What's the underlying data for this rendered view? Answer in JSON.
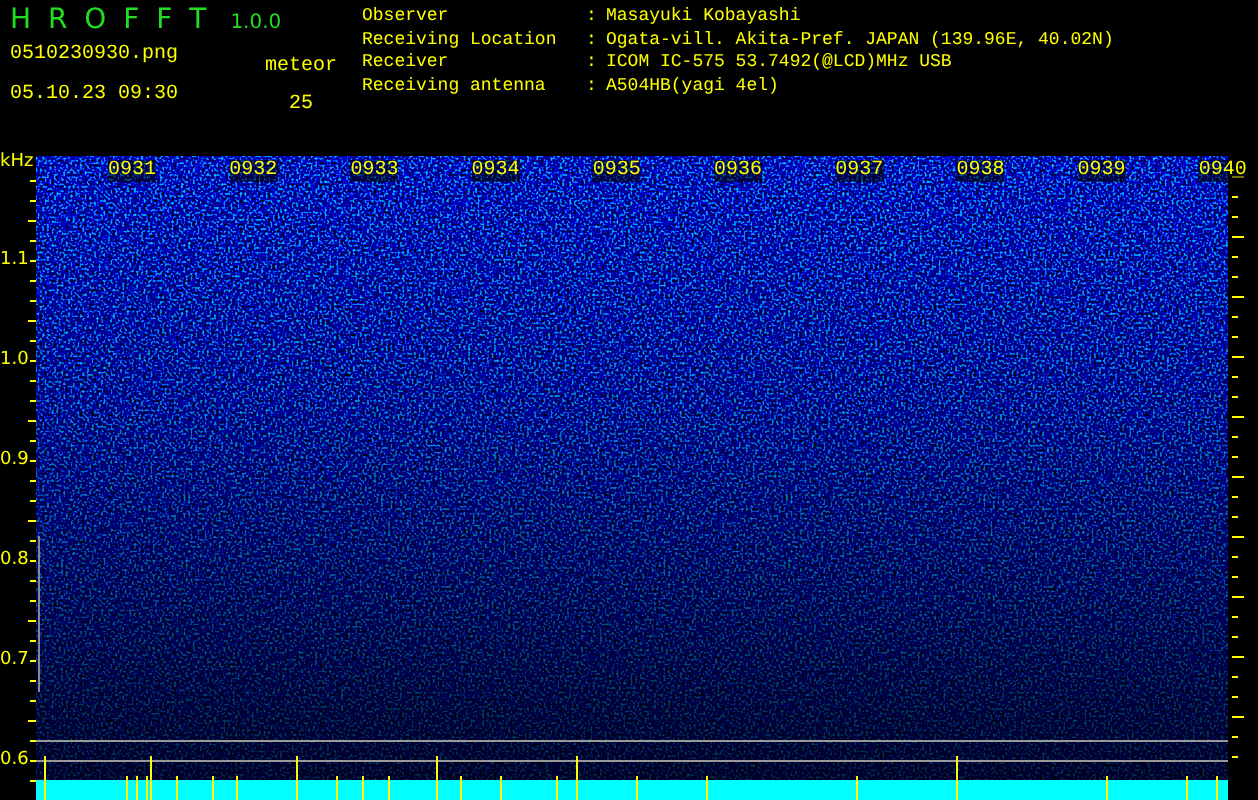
{
  "app": {
    "name": "H R O F F T",
    "version": "1.0.0"
  },
  "file": {
    "name": "0510230930.png",
    "datetime": "05.10.23 09:30"
  },
  "meteor": {
    "label": "meteor",
    "count": "25"
  },
  "info": [
    {
      "label": "Observer",
      "separator": ":",
      "value": "Masayuki Kobayashi"
    },
    {
      "label": "Receiving Location",
      "separator": ":",
      "value": "Ogata-vill. Akita-Pref. JAPAN (139.96E, 40.02N)"
    },
    {
      "label": "Receiver",
      "separator": ":",
      "value": "ICOM IC-575 53.7492(@LCD)MHz USB"
    },
    {
      "label": "Receiving antenna",
      "separator": ":",
      "value": "A504HB(yagi 4el)"
    }
  ],
  "spectrogram": {
    "unit": "kHz",
    "freq_labels": [
      "1.1",
      "1.0",
      "0.9",
      "0.8",
      "0.7",
      "0.6"
    ],
    "time_labels": [
      "0931",
      "0932",
      "0933",
      "0934",
      "0935",
      "0936",
      "0937",
      "0938",
      "0939",
      "0940"
    ]
  }
}
